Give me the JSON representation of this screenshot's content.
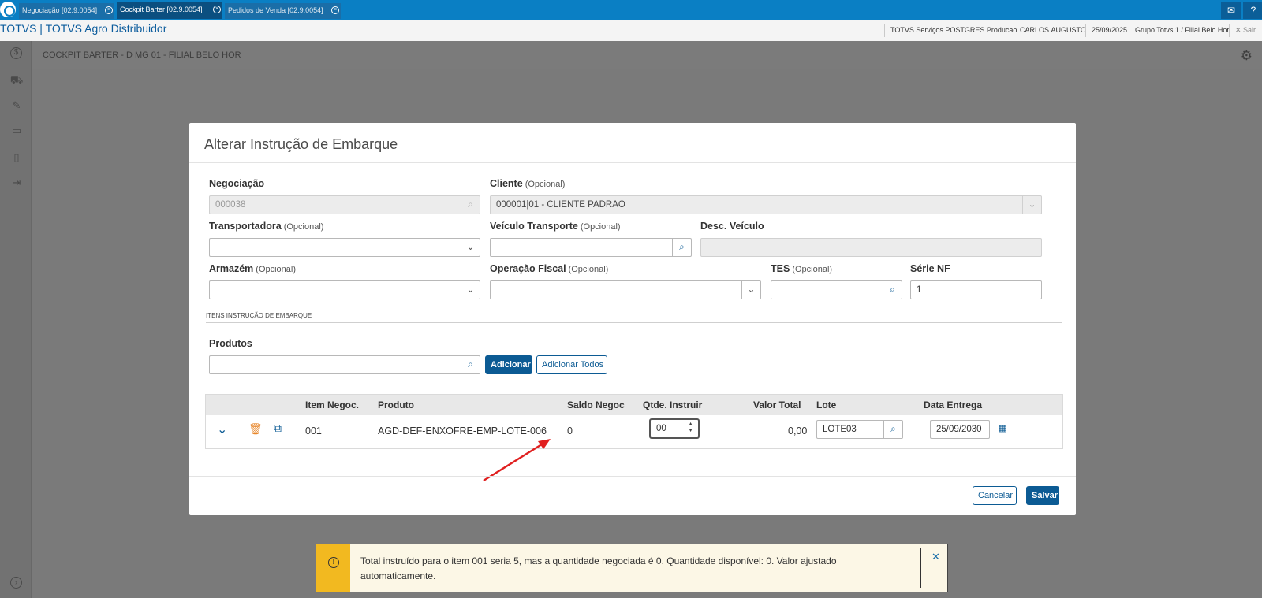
{
  "tabs": [
    {
      "label": "Negociação [02.9.0054]"
    },
    {
      "label": "Cockpit Barter [02.9.0054]"
    },
    {
      "label": "Pedidos de Venda [02.9.0054]"
    }
  ],
  "app": {
    "title": "TOTVS | TOTVS Agro Distribuidor"
  },
  "header": {
    "environment": "TOTVS Serviços POSTGRES Producao",
    "user": "CARLOS.AUGUSTO",
    "date": "25/09/2025",
    "group": "Grupo Totvs 1 / Filial Belo Hor",
    "exit_label": "Sair"
  },
  "page": {
    "title": "COCKPIT BARTER - D MG 01 - FILIAL BELO HOR"
  },
  "modal": {
    "title": "Alterar Instrução de Embarque",
    "optional": "(Opcional)",
    "fields": {
      "negociacao": {
        "label": "Negociação",
        "value": "000038"
      },
      "cliente": {
        "label": "Cliente",
        "value": "000001|01 - CLIENTE PADRAO"
      },
      "transportadora": {
        "label": "Transportadora",
        "value": ""
      },
      "veiculo": {
        "label": "Veículo Transporte",
        "value": ""
      },
      "desc_veiculo": {
        "label": "Desc. Veículo",
        "value": ""
      },
      "armazem": {
        "label": "Armazém",
        "value": ""
      },
      "operacao": {
        "label": "Operação Fiscal",
        "value": ""
      },
      "tes": {
        "label": "TES",
        "value": ""
      },
      "serie": {
        "label": "Série NF",
        "value": "1"
      }
    },
    "section_label": "ITENS INSTRUÇÃO DE EMBARQUE",
    "produtos": {
      "label": "Produtos",
      "value": ""
    },
    "add_button": "Adicionar",
    "add_all_button": "Adicionar Todos",
    "table": {
      "headers": [
        "Item Negoc.",
        "Produto",
        "Saldo Negoc",
        "Qtde. Instruir",
        "Valor Total",
        "Lote",
        "Data Entrega"
      ],
      "rows": [
        {
          "item": "001",
          "produto": "AGD-DEF-ENXOFRE-EMP-LOTE-006",
          "saldo": "0",
          "qtde": "00",
          "valor": "0,00",
          "lote": "LOTE03",
          "data": "25/09/2030"
        }
      ]
    },
    "cancel_button": "Cancelar",
    "save_button": "Salvar"
  },
  "notification": {
    "icon": "warning-icon",
    "text": "Total instruído para o item 001 seria 5, mas a quantidade negociada é 0. Quantidade disponível: 0. Valor ajustado automaticamente."
  },
  "colors": {
    "accent": "#0c5b94",
    "topbar": "#0a7fc4",
    "warning": "#f2b920",
    "annotation_arrow": "#e02020"
  }
}
